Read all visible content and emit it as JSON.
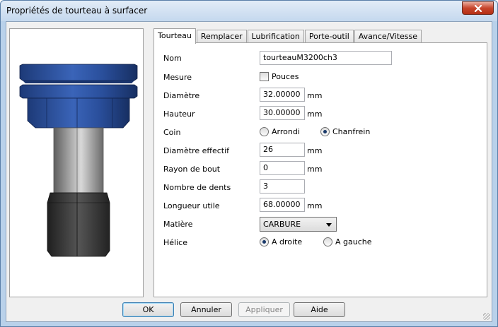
{
  "window": {
    "title": "Propriétés de tourteau à surfacer"
  },
  "tabs": [
    {
      "label": "Tourteau",
      "active": true
    },
    {
      "label": "Remplacer",
      "active": false
    },
    {
      "label": "Lubrification",
      "active": false
    },
    {
      "label": "Porte-outil",
      "active": false
    },
    {
      "label": "Avance/Vitesse",
      "active": false
    }
  ],
  "form": {
    "nom": {
      "label": "Nom",
      "value": "tourteauM3200ch3"
    },
    "mesure": {
      "label": "Mesure",
      "checkbox_label": "Pouces",
      "checked": false
    },
    "diametre": {
      "label": "Diamètre",
      "value": "32.00000",
      "unit": "mm"
    },
    "hauteur": {
      "label": "Hauteur",
      "value": "30.00000",
      "unit": "mm"
    },
    "coin": {
      "label": "Coin",
      "option1": "Arrondi",
      "option2": "Chanfrein",
      "selected": "Chanfrein"
    },
    "diametre_effectif": {
      "label": "Diamètre effectif",
      "value": "26",
      "unit": "mm"
    },
    "rayon_de_bout": {
      "label": "Rayon de bout",
      "value": "0",
      "unit": "mm"
    },
    "nombre_de_dents": {
      "label": "Nombre de dents",
      "value": "3"
    },
    "longueur_utile": {
      "label": "Longueur utile",
      "value": "68.00000",
      "unit": "mm"
    },
    "matiere": {
      "label": "Matière",
      "value": "CARBURE"
    },
    "helice": {
      "label": "Hélice",
      "option1": "A droite",
      "option2": "A gauche",
      "selected": "A droite"
    }
  },
  "buttons": {
    "ok": "OK",
    "annuler": "Annuler",
    "appliquer": "Appliquer",
    "aide": "Aide"
  },
  "colors": {
    "tool_head": "#2a4f9c",
    "tool_shank": "#9a9a9a",
    "tool_body": "#3a3a3a",
    "close_button": "#c7452c"
  }
}
